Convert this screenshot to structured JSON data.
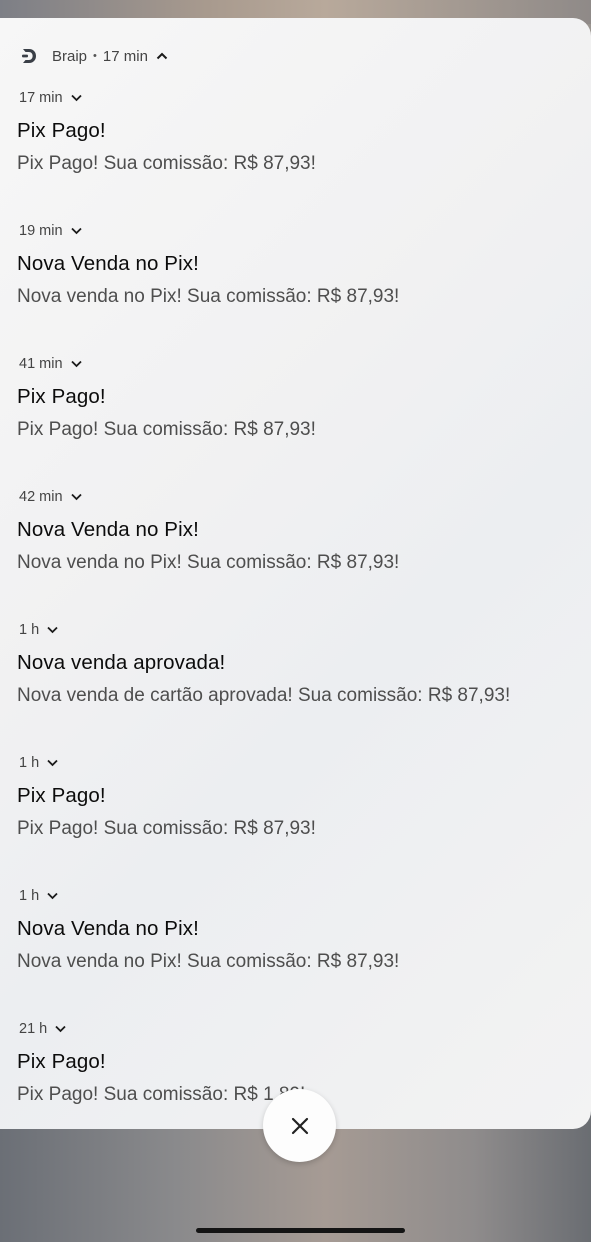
{
  "header": {
    "app_name": "Braip",
    "separator": "•",
    "time": "17 min"
  },
  "notifications": [
    {
      "time": "17 min",
      "title": "Pix Pago!",
      "body": "Pix Pago! Sua comissão: R$ 87,93!"
    },
    {
      "time": "19 min",
      "title": "Nova Venda no Pix!",
      "body": "Nova venda no Pix! Sua comissão: R$ 87,93!"
    },
    {
      "time": "41 min",
      "title": "Pix Pago!",
      "body": "Pix Pago! Sua comissão: R$ 87,93!"
    },
    {
      "time": "42 min",
      "title": "Nova Venda no Pix!",
      "body": "Nova venda no Pix! Sua comissão: R$ 87,93!"
    },
    {
      "time": "1 h",
      "title": "Nova venda aprovada!",
      "body": "Nova venda de cartão aprovada! Sua comissão: R$ 87,93!"
    },
    {
      "time": "1 h",
      "title": "Pix Pago!",
      "body": "Pix Pago! Sua comissão: R$ 87,93!"
    },
    {
      "time": "1 h",
      "title": "Nova Venda no Pix!",
      "body": "Nova venda no Pix! Sua comissão: R$ 87,93!"
    },
    {
      "time": "21 h",
      "title": "Pix Pago!",
      "body": "Pix Pago! Sua comissão: R$ 1​   89!"
    }
  ],
  "icons": {
    "app_logo": "braip-logo-icon",
    "header_chevron": "chevron-up-icon",
    "item_chevron": "chevron-down-icon",
    "close": "close-icon"
  }
}
